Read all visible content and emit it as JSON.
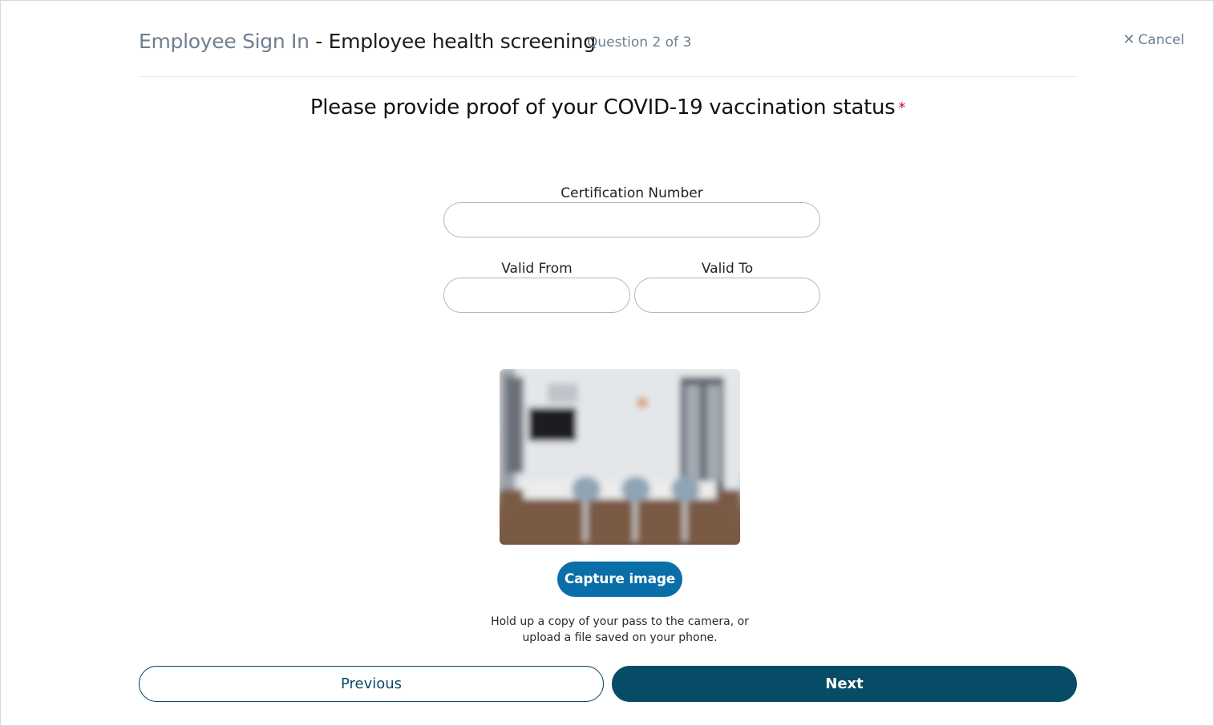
{
  "header": {
    "app_name": "Employee Sign In",
    "separator": " - ",
    "flow_name": "Employee health screening",
    "progress": "Question 2 of 3",
    "cancel_label": "Cancel",
    "cancel_icon": "close-icon"
  },
  "question": {
    "text": "Please provide proof of your COVID-19 vaccination status",
    "required_marker": "*"
  },
  "form": {
    "certification_number": {
      "label": "Certification Number",
      "value": ""
    },
    "valid_from": {
      "label": "Valid From",
      "value": ""
    },
    "valid_to": {
      "label": "Valid To",
      "value": ""
    }
  },
  "camera": {
    "capture_label": "Capture image",
    "helper_line1": "Hold up a copy of your pass to the camera, or",
    "helper_line2": "upload a file saved on your phone."
  },
  "navigation": {
    "previous_label": "Previous",
    "next_label": "Next"
  },
  "colors": {
    "primary_blue": "#0a6ea8",
    "dark_teal": "#074c67",
    "muted_gray": "#6e7f8f",
    "required_red": "#c8102e"
  }
}
